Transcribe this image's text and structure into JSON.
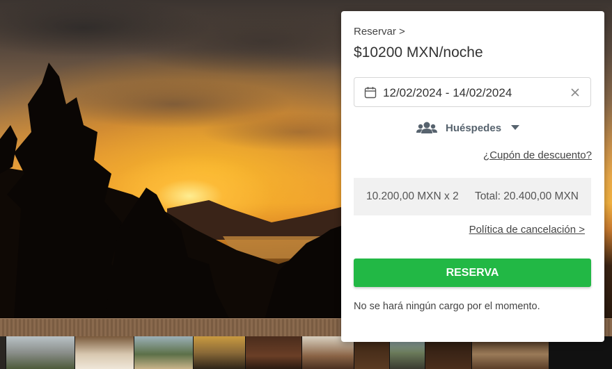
{
  "booking": {
    "breadcrumb": "Reservar >",
    "price_per_night": "$10200 MXN/noche",
    "date_range": "12/02/2024 - 14/02/2024",
    "guests_label": "Huéspedes",
    "coupon_link": "¿Cupón de descuento?",
    "price_breakdown": "10.200,00 MXN x 2",
    "total": "Total: 20.400,00 MXN",
    "cancellation_link": "Política de cancelación >",
    "reserve_button": "RESERVA",
    "no_charge_note": "No se hará ningún cargo por el momento."
  },
  "colors": {
    "reserve_button": "#22b845",
    "guests_text": "#57636e",
    "summary_bg": "#f1f1f1"
  },
  "icons": {
    "date": "calendar-icon",
    "clear": "close-icon",
    "guests": "users-icon",
    "guests_toggle": "caret-down-icon"
  },
  "gallery": {
    "thumbnail_count": 11
  }
}
